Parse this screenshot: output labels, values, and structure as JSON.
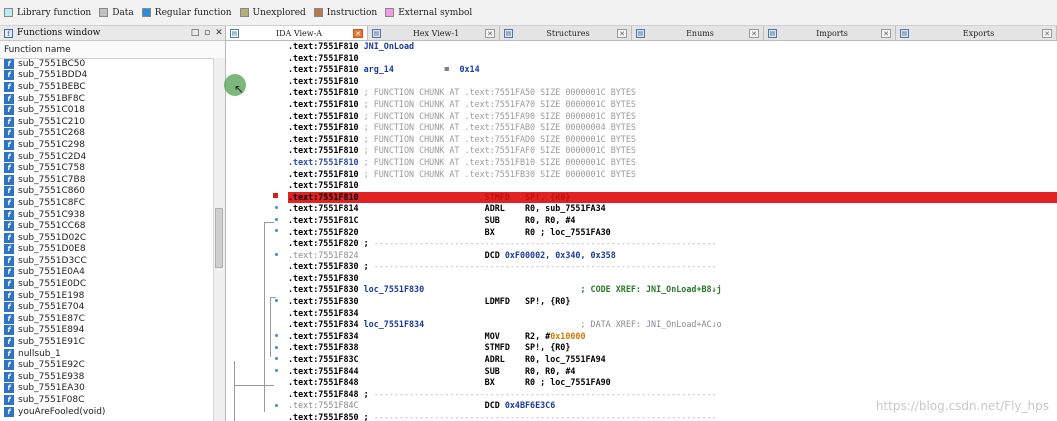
{
  "legend": [
    {
      "label": "Library function",
      "color": "#bfe8f5"
    },
    {
      "label": "Data",
      "color": "#c0c0c0"
    },
    {
      "label": "Regular function",
      "color": "#2d8ddc"
    },
    {
      "label": "Unexplored",
      "color": "#b5ad7a"
    },
    {
      "label": "Instruction",
      "color": "#b87a4a"
    },
    {
      "label": "External symbol",
      "color": "#f49ae6"
    }
  ],
  "functions_window": {
    "title": "Functions window",
    "column_header": "Function name",
    "icon_glyph": "f",
    "functions": [
      "sub_7551BC50",
      "sub_7551BDD4",
      "sub_7551BEBC",
      "sub_7551BF8C",
      "sub_7551C018",
      "sub_7551C210",
      "sub_7551C268",
      "sub_7551C298",
      "sub_7551C2D4",
      "sub_7551C758",
      "sub_7551C7B8",
      "sub_7551C860",
      "sub_7551C8FC",
      "sub_7551C938",
      "sub_7551CC68",
      "sub_7551D02C",
      "sub_7551D0E8",
      "sub_7551D3CC",
      "sub_7551E0A4",
      "sub_7551E0DC",
      "sub_7551E198",
      "sub_7551E704",
      "sub_7551E87C",
      "sub_7551E894",
      "sub_7551E91C",
      "nullsub_1",
      "sub_7551E92C",
      "sub_7551E938",
      "sub_7551EA30",
      "sub_7551F08C",
      "youAreFooled(void)"
    ]
  },
  "tabs": [
    {
      "label": "IDA View-A",
      "icon": "ida-view-icon",
      "active": true
    },
    {
      "label": "Hex View-1",
      "icon": "hex-view-icon",
      "active": false
    },
    {
      "label": "Structures",
      "icon": "structures-icon",
      "active": false
    },
    {
      "label": "Enums",
      "icon": "enums-icon",
      "active": false
    },
    {
      "label": "Imports",
      "icon": "imports-icon",
      "active": false
    },
    {
      "label": "Exports",
      "icon": "exports-icon",
      "active": false
    }
  ],
  "disassembly": [
    {
      "addr": ".text:7551F810",
      "addr_style": "normal",
      "parts": [
        [
          "name",
          " JNI_OnLoad"
        ]
      ]
    },
    {
      "addr": ".text:7551F810",
      "addr_style": "normal",
      "parts": []
    },
    {
      "addr": ".text:7551F810",
      "addr_style": "normal",
      "parts": [
        [
          "name",
          " arg_14"
        ],
        [
          "plain",
          "          =  "
        ],
        [
          "data",
          "0x14"
        ]
      ]
    },
    {
      "addr": ".text:7551F810",
      "addr_style": "normal",
      "parts": []
    },
    {
      "addr": ".text:7551F810",
      "addr_style": "normal",
      "parts": [
        [
          "cmt",
          " ; FUNCTION CHUNK AT .text:7551FA50 SIZE 0000001C BYTES"
        ]
      ]
    },
    {
      "addr": ".text:7551F810",
      "addr_style": "normal",
      "parts": [
        [
          "cmt",
          " ; FUNCTION CHUNK AT .text:7551FA70 SIZE 0000001C BYTES"
        ]
      ]
    },
    {
      "addr": ".text:7551F810",
      "addr_style": "normal",
      "parts": [
        [
          "cmt",
          " ; FUNCTION CHUNK AT .text:7551FA90 SIZE 0000001C BYTES"
        ]
      ]
    },
    {
      "addr": ".text:7551F810",
      "addr_style": "normal",
      "parts": [
        [
          "cmt",
          " ; FUNCTION CHUNK AT .text:7551FAB0 SIZE 00000004 BYTES"
        ]
      ]
    },
    {
      "addr": ".text:7551F810",
      "addr_style": "normal",
      "parts": [
        [
          "cmt",
          " ; FUNCTION CHUNK AT .text:7551FAD0 SIZE 0000001C BYTES"
        ]
      ]
    },
    {
      "addr": ".text:7551F810",
      "addr_style": "normal",
      "parts": [
        [
          "cmt",
          " ; FUNCTION CHUNK AT .text:7551FAF0 SIZE 0000001C BYTES"
        ]
      ]
    },
    {
      "addr": ".text:7551F810",
      "addr_style": "blue",
      "parts": [
        [
          "cmt",
          " ; FUNCTION CHUNK AT .text:7551FB10 SIZE 0000001C BYTES"
        ]
      ]
    },
    {
      "addr": ".text:7551F810",
      "addr_style": "normal",
      "parts": [
        [
          "cmt",
          " ; FUNCTION CHUNK AT .text:7551FB30 SIZE 0000001C BYTES"
        ]
      ]
    },
    {
      "addr": ".text:7551F810",
      "addr_style": "normal",
      "parts": []
    },
    {
      "addr": ".text:7551F810",
      "addr_style": "highlight",
      "parts": [
        [
          "plain",
          "                         STMFD   SP!, {R0}"
        ]
      ]
    },
    {
      "addr": ".text:7551F814",
      "addr_style": "normal",
      "parts": [
        [
          "plain",
          "                         ADRL    R0, sub_7551FA34"
        ]
      ]
    },
    {
      "addr": ".text:7551F81C",
      "addr_style": "normal",
      "parts": [
        [
          "plain",
          "                         SUB     R0, R0, #4"
        ]
      ]
    },
    {
      "addr": ".text:7551F820",
      "addr_style": "normal",
      "parts": [
        [
          "plain",
          "                         BX      R0 ; loc_7551FA30"
        ]
      ]
    },
    {
      "addr": ".text:7551F820",
      "addr_style": "normal",
      "parts": [
        [
          "plain",
          " ; "
        ],
        [
          "sep",
          "--------------------------------------------------------------------"
        ]
      ]
    },
    {
      "addr": ".text:7551F824",
      "addr_style": "gray",
      "parts": [
        [
          "plain",
          "                         DCD "
        ],
        [
          "data",
          "0xF00002, 0x340, 0x358"
        ]
      ]
    },
    {
      "addr": ".text:7551F830",
      "addr_style": "normal",
      "parts": [
        [
          "plain",
          " ; "
        ],
        [
          "sep",
          "--------------------------------------------------------------------"
        ]
      ]
    },
    {
      "addr": ".text:7551F830",
      "addr_style": "normal",
      "parts": []
    },
    {
      "addr": ".text:7551F830",
      "addr_style": "normal",
      "parts": [
        [
          "name",
          " loc_7551F830"
        ],
        [
          "plain",
          "                               "
        ],
        [
          "xref",
          "; CODE XREF: JNI_OnLoad+B8↓j"
        ]
      ]
    },
    {
      "addr": ".text:7551F830",
      "addr_style": "normal",
      "parts": [
        [
          "plain",
          "                         LDMFD   SP!, {R0}"
        ]
      ]
    },
    {
      "addr": ".text:7551F834",
      "addr_style": "normal",
      "parts": []
    },
    {
      "addr": ".text:7551F834",
      "addr_style": "normal",
      "parts": [
        [
          "name",
          " loc_7551F834"
        ],
        [
          "plain",
          "                               "
        ],
        [
          "dxref",
          "; DATA XREF: JNI_OnLoad+AC↓o"
        ]
      ]
    },
    {
      "addr": ".text:7551F834",
      "addr_style": "normal",
      "parts": [
        [
          "plain",
          "                         MOV     R2, #"
        ],
        [
          "num",
          "0x10000"
        ]
      ]
    },
    {
      "addr": ".text:7551F838",
      "addr_style": "normal",
      "parts": [
        [
          "plain",
          "                         STMFD   SP!, {R0}"
        ]
      ]
    },
    {
      "addr": ".text:7551F83C",
      "addr_style": "normal",
      "parts": [
        [
          "plain",
          "                         ADRL    R0, loc_7551FA94"
        ]
      ]
    },
    {
      "addr": ".text:7551F844",
      "addr_style": "normal",
      "parts": [
        [
          "plain",
          "                         SUB     R0, R0, #4"
        ]
      ]
    },
    {
      "addr": ".text:7551F848",
      "addr_style": "normal",
      "parts": [
        [
          "plain",
          "                         BX      R0 ; loc_7551FA90"
        ]
      ]
    },
    {
      "addr": ".text:7551F848",
      "addr_style": "normal",
      "parts": [
        [
          "plain",
          " ; "
        ],
        [
          "sep",
          "--------------------------------------------------------------------"
        ]
      ]
    },
    {
      "addr": ".text:7551F84C",
      "addr_style": "gray",
      "parts": [
        [
          "plain",
          "                         DCD "
        ],
        [
          "data",
          "0x4BF6E3C6"
        ]
      ]
    },
    {
      "addr": ".text:7551F850",
      "addr_style": "normal",
      "parts": [
        [
          "plain",
          " ; "
        ],
        [
          "sep",
          "--------------------------------------------------------------------"
        ]
      ]
    }
  ],
  "watermark": "https://blog.csdn.net/Fly_hps"
}
